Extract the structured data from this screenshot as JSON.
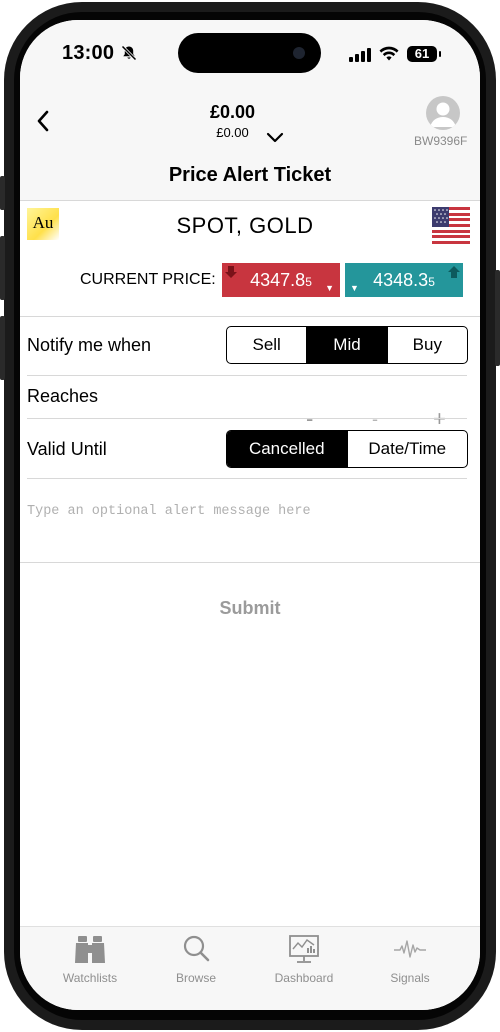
{
  "status_bar": {
    "time": "13:00",
    "battery": "61"
  },
  "header": {
    "balance_main": "£0.00",
    "balance_sub": "£0.00",
    "user_id": "BW9396F"
  },
  "page_title": "Price Alert Ticket",
  "instrument": {
    "symbol_badge": "Au",
    "name": "SPOT, GOLD",
    "flag": "us-flag-icon"
  },
  "prices": {
    "label": "CURRENT PRICE:",
    "sell_main": "4347.8",
    "sell_small": "5",
    "buy_main": "4348.3",
    "buy_small": "5"
  },
  "notify": {
    "label": "Notify me when",
    "options": [
      "Sell",
      "Mid",
      "Buy"
    ],
    "selected": "Mid"
  },
  "reaches": {
    "label": "Reaches",
    "decrement": "-",
    "value": "-",
    "increment": "+"
  },
  "valid_until": {
    "label": "Valid Until",
    "options": [
      "Cancelled",
      "Date/Time"
    ],
    "selected": "Cancelled"
  },
  "message": {
    "placeholder": "Type an optional alert message here"
  },
  "submit_label": "Submit",
  "tabs": [
    {
      "label": "Watchlists",
      "icon": "binoculars-icon"
    },
    {
      "label": "Browse",
      "icon": "search-icon"
    },
    {
      "label": "Dashboard",
      "icon": "dashboard-icon"
    },
    {
      "label": "Signals",
      "icon": "signals-icon"
    }
  ],
  "colors": {
    "sell": "#c8353f",
    "buy": "#24969b",
    "selected_segment": "#000000"
  }
}
